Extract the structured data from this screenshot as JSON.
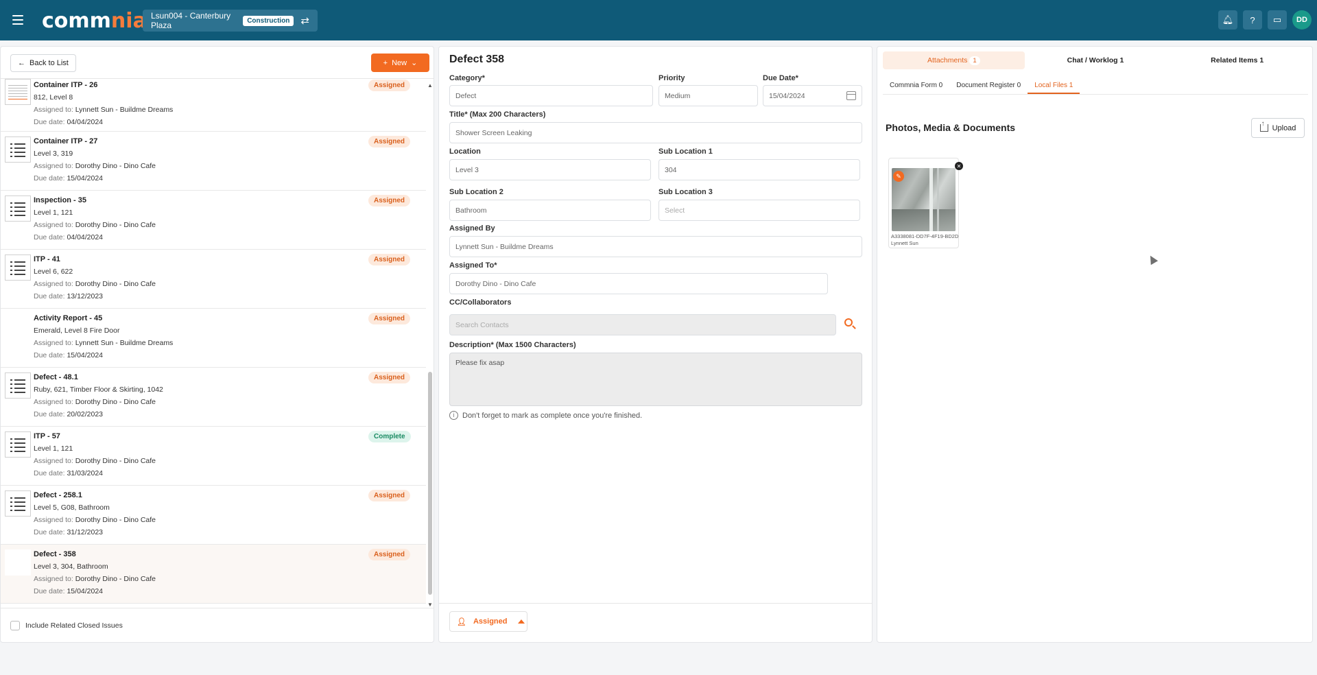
{
  "header": {
    "logo_prefix": "comm",
    "logo_accent": "nia",
    "project_name": "Lsun004 - Canterbury Plaza",
    "project_tag": "Construction",
    "avatar_initials": "DD"
  },
  "left": {
    "back_label": "Back to List",
    "new_label": "New",
    "include_closed_label": "Include Related Closed Issues",
    "assigned_prefix": "Assigned to:",
    "due_prefix": "Due date:",
    "items": [
      {
        "title": "Container ITP - 26",
        "location": "812, Level 8",
        "assigned_to": "Lynnett Sun - Buildme Dreams",
        "due": "04/04/2024",
        "status": "Assigned",
        "thumb": "doc"
      },
      {
        "title": "Container ITP - 27",
        "location": "Level 3, 319",
        "assigned_to": "Dorothy Dino - Dino Cafe",
        "due": "15/04/2024",
        "status": "Assigned",
        "thumb": "list"
      },
      {
        "title": "Inspection - 35",
        "location": "Level 1, 121",
        "assigned_to": "Dorothy Dino - Dino Cafe",
        "due": "04/04/2024",
        "status": "Assigned",
        "thumb": "list"
      },
      {
        "title": "ITP - 41",
        "location": "Level 6, 622",
        "assigned_to": "Dorothy Dino - Dino Cafe",
        "due": "13/12/2023",
        "status": "Assigned",
        "thumb": "list"
      },
      {
        "title": "Activity Report - 45",
        "location": "Emerald, Level 8 Fire Door",
        "assigned_to": "Lynnett Sun - Buildme Dreams",
        "due": "15/04/2024",
        "status": "Assigned",
        "thumb": "photo"
      },
      {
        "title": "Defect - 48.1",
        "location": "Ruby, 621, Timber Floor & Skirting, 1042",
        "assigned_to": "Dorothy Dino - Dino Cafe",
        "due": "20/02/2023",
        "status": "Assigned",
        "thumb": "list"
      },
      {
        "title": "ITP - 57",
        "location": "Level 1, 121",
        "assigned_to": "Dorothy Dino - Dino Cafe",
        "due": "31/03/2024",
        "status": "Complete",
        "thumb": "list"
      },
      {
        "title": "Defect - 258.1",
        "location": "Level 5, G08, Bathroom",
        "assigned_to": "Dorothy Dino - Dino Cafe",
        "due": "31/12/2023",
        "status": "Assigned",
        "thumb": "list"
      },
      {
        "title": "Defect - 358",
        "location": "Level 3, 304, Bathroom",
        "assigned_to": "Dorothy Dino - Dino Cafe",
        "due": "15/04/2024",
        "status": "Assigned",
        "thumb": "photo2",
        "selected": true
      }
    ]
  },
  "form": {
    "title": "Defect 358",
    "category_label": "Category*",
    "category_value": "Defect",
    "priority_label": "Priority",
    "priority_value": "Medium",
    "due_label": "Due Date*",
    "due_value": "15/04/2024",
    "title_label": "Title* (Max 200 Characters)",
    "title_value": "Shower Screen Leaking",
    "location_label": "Location",
    "location_value": "Level 3",
    "subloc1_label": "Sub Location 1",
    "subloc1_value": "304",
    "subloc2_label": "Sub Location 2",
    "subloc2_value": "Bathroom",
    "subloc3_label": "Sub Location 3",
    "subloc3_placeholder": "Select",
    "assigned_by_label": "Assigned By",
    "assigned_by_value": "Lynnett Sun - Buildme Dreams",
    "assigned_to_label": "Assigned To*",
    "assigned_to_value": "Dorothy Dino - Dino Cafe",
    "cc_label": "CC/Collaborators",
    "cc_placeholder": "Search Contacts",
    "description_label": "Description* (Max 1500 Characters)",
    "description_value": "Please fix asap",
    "note": "Don't forget to mark as complete once you're finished.",
    "status_button": "Assigned"
  },
  "right": {
    "tabs": [
      {
        "label": "Attachments",
        "count": "1"
      },
      {
        "label": "Chat / Worklog 1"
      },
      {
        "label": "Related Items 1"
      }
    ],
    "subtabs": [
      "Commnia Form 0",
      "Document Register 0",
      "Local Files 1"
    ],
    "heading": "Photos, Media & Documents",
    "upload_label": "Upload",
    "file": {
      "name": "A3338081-DD7F-4F19-BD2D-...",
      "owner": "Lynnett Sun"
    }
  },
  "colors": {
    "brand": "#0f5a78",
    "accent": "#f26a21",
    "complete": "#1a8a62"
  }
}
